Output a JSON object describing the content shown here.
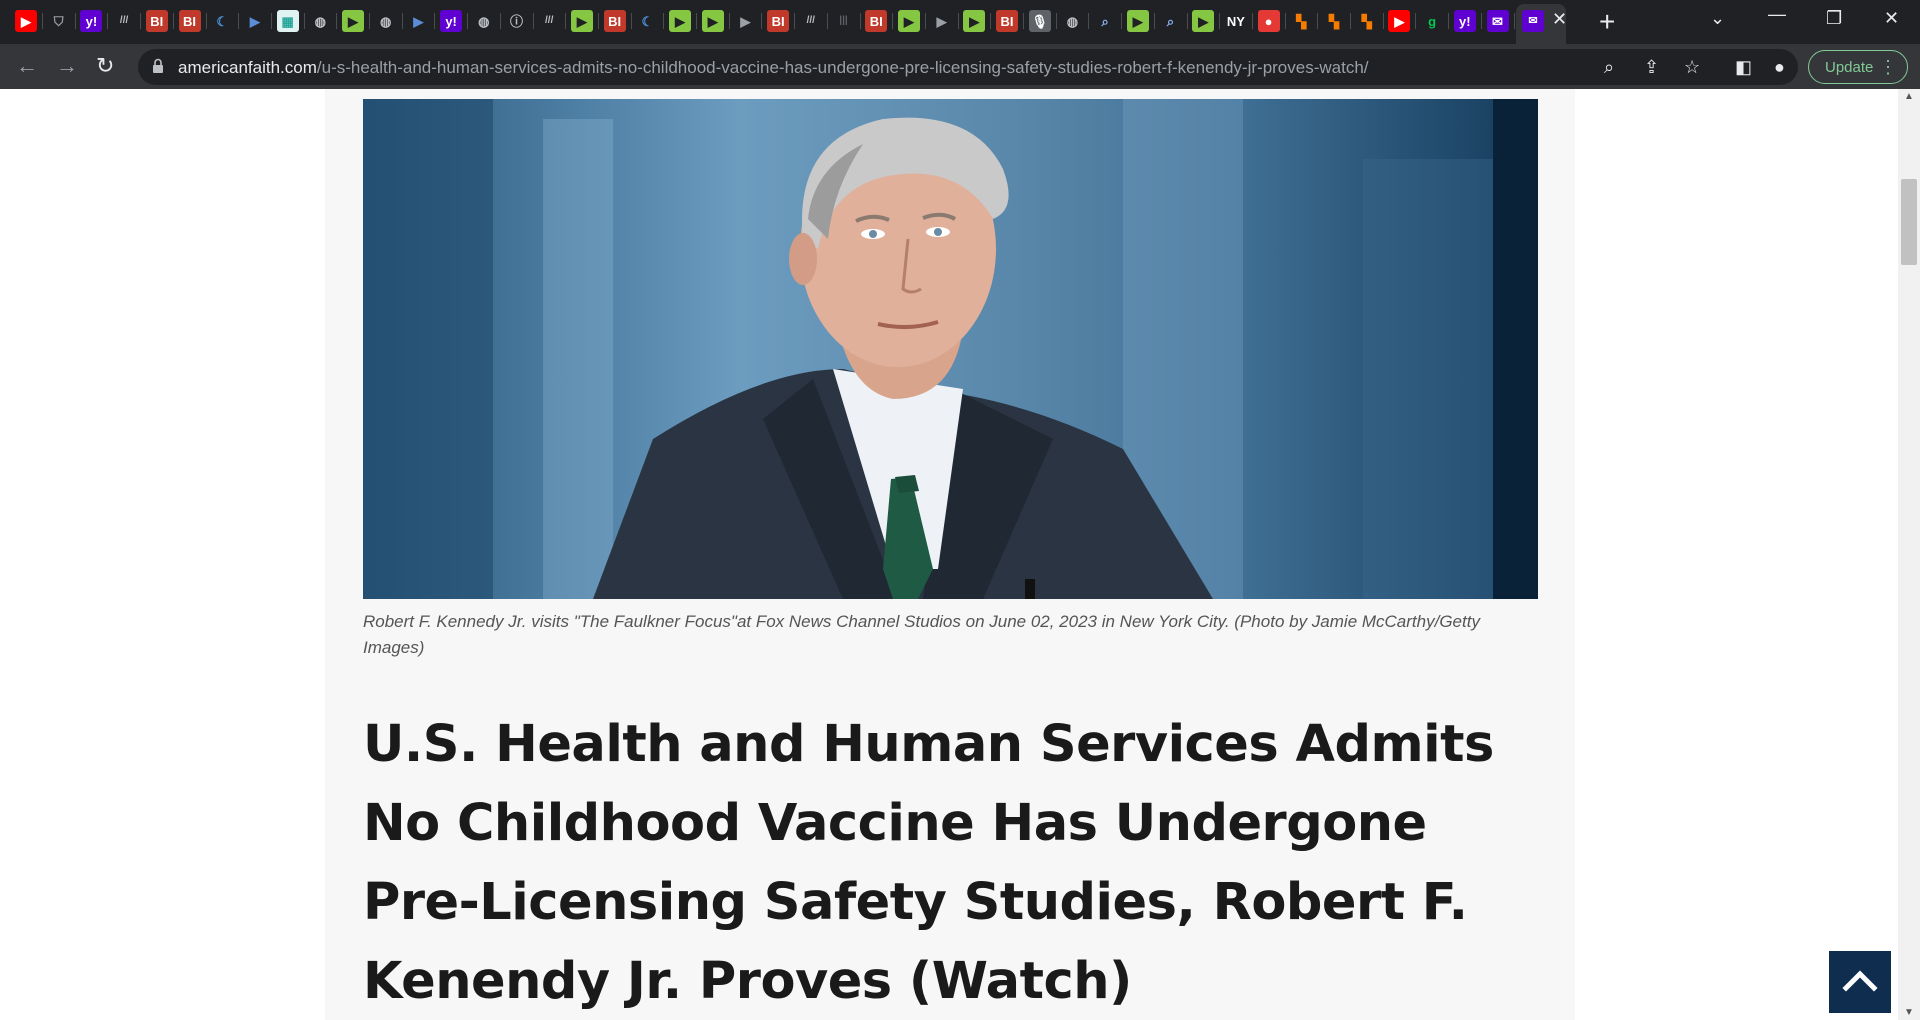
{
  "browser": {
    "tabs": [
      {
        "icon": "youtube-icon",
        "glyph": "▶",
        "color": "#ff0000",
        "fg": "#ffffff"
      },
      {
        "icon": "shield-icon",
        "glyph": "⛉",
        "color": "transparent",
        "fg": "#9aa0a6"
      },
      {
        "icon": "yahoo-icon",
        "glyph": "y!",
        "color": "#5f01d1",
        "fg": "#ffffff"
      },
      {
        "icon": "slashes-icon",
        "glyph": "///",
        "color": "transparent",
        "fg": "#bdc1c6"
      },
      {
        "icon": "business-insider-icon",
        "glyph": "BI",
        "color": "#c0392b",
        "fg": "#ffffff"
      },
      {
        "icon": "business-insider-icon",
        "glyph": "BI",
        "color": "#c0392b",
        "fg": "#ffffff"
      },
      {
        "icon": "shield-blue-icon",
        "glyph": "☾",
        "color": "transparent",
        "fg": "#4a90d9"
      },
      {
        "icon": "flag-icon",
        "glyph": "▶",
        "color": "transparent",
        "fg": "#5b8dd6"
      },
      {
        "icon": "map-icon",
        "glyph": "▦",
        "color": "#e0f2f1",
        "fg": "#26a69a"
      },
      {
        "icon": "globe-icon",
        "glyph": "◍",
        "color": "transparent",
        "fg": "#bdc1c6"
      },
      {
        "icon": "rumble-icon",
        "glyph": "▶",
        "color": "#85c742",
        "fg": "#202124"
      },
      {
        "icon": "globe-icon",
        "glyph": "◍",
        "color": "transparent",
        "fg": "#bdc1c6"
      },
      {
        "icon": "flag-icon",
        "glyph": "▶",
        "color": "transparent",
        "fg": "#5b8dd6"
      },
      {
        "icon": "yahoo-icon",
        "glyph": "y!",
        "color": "#5f01d1",
        "fg": "#ffffff"
      },
      {
        "icon": "globe-icon",
        "glyph": "◍",
        "color": "transparent",
        "fg": "#bdc1c6"
      },
      {
        "icon": "info-icon",
        "glyph": "ⓘ",
        "color": "transparent",
        "fg": "#bdc1c6"
      },
      {
        "icon": "slashes-icon",
        "glyph": "///",
        "color": "transparent",
        "fg": "#bdc1c6"
      },
      {
        "icon": "rumble-icon",
        "glyph": "▶",
        "color": "#85c742",
        "fg": "#202124"
      },
      {
        "icon": "business-insider-icon",
        "glyph": "BI",
        "color": "#c0392b",
        "fg": "#ffffff"
      },
      {
        "icon": "shield-blue-icon",
        "glyph": "☾",
        "color": "transparent",
        "fg": "#4a90d9"
      },
      {
        "icon": "rumble-icon",
        "glyph": "▶",
        "color": "#85c742",
        "fg": "#202124"
      },
      {
        "icon": "rumble-icon",
        "glyph": "▶",
        "color": "#85c742",
        "fg": "#202124"
      },
      {
        "icon": "flag-icon",
        "glyph": "▶",
        "color": "transparent",
        "fg": "#9aa0a6"
      },
      {
        "icon": "business-insider-icon",
        "glyph": "BI",
        "color": "#c0392b",
        "fg": "#ffffff"
      },
      {
        "icon": "slashes-icon",
        "glyph": "///",
        "color": "transparent",
        "fg": "#bdc1c6"
      },
      {
        "icon": "barcode-icon",
        "glyph": "|||",
        "color": "transparent",
        "fg": "#5f6368"
      },
      {
        "icon": "business-insider-icon",
        "glyph": "BI",
        "color": "#c0392b",
        "fg": "#ffffff"
      },
      {
        "icon": "rumble-icon",
        "glyph": "▶",
        "color": "#85c742",
        "fg": "#202124"
      },
      {
        "icon": "flag-icon",
        "glyph": "▶",
        "color": "transparent",
        "fg": "#9aa0a6"
      },
      {
        "icon": "rumble-icon",
        "glyph": "▶",
        "color": "#85c742",
        "fg": "#202124"
      },
      {
        "icon": "business-insider-icon",
        "glyph": "BI",
        "color": "#c0392b",
        "fg": "#ffffff"
      },
      {
        "icon": "microphone-icon",
        "glyph": "🎙",
        "color": "#5f6368",
        "fg": "#ffffff"
      },
      {
        "icon": "globe-icon",
        "glyph": "◍",
        "color": "transparent",
        "fg": "#bdc1c6"
      },
      {
        "icon": "search-icon",
        "glyph": "⌕",
        "color": "transparent",
        "fg": "#8ab4f8"
      },
      {
        "icon": "rumble-icon",
        "glyph": "▶",
        "color": "#85c742",
        "fg": "#202124"
      },
      {
        "icon": "search-icon",
        "glyph": "⌕",
        "color": "transparent",
        "fg": "#8ab4f8"
      },
      {
        "icon": "rumble-icon",
        "glyph": "▶",
        "color": "#85c742",
        "fg": "#202124"
      },
      {
        "icon": "news-icon",
        "glyph": "NY",
        "color": "#202124",
        "fg": "#ffffff"
      },
      {
        "icon": "podcast-icon",
        "glyph": "●",
        "color": "#e53935",
        "fg": "#ffffff"
      },
      {
        "icon": "bookmark-icon",
        "glyph": "▚",
        "color": "transparent",
        "fg": "#f57c00"
      },
      {
        "icon": "bookmark-icon",
        "glyph": "▚",
        "color": "transparent",
        "fg": "#f57c00"
      },
      {
        "icon": "bookmark-icon",
        "glyph": "▚",
        "color": "transparent",
        "fg": "#f57c00"
      },
      {
        "icon": "youtube-icon",
        "glyph": "▶",
        "color": "#ff0000",
        "fg": "#ffffff"
      },
      {
        "icon": "g-icon",
        "glyph": "g",
        "color": "transparent",
        "fg": "#00c853"
      },
      {
        "icon": "yahoo-icon",
        "glyph": "y!",
        "color": "#5f01d1",
        "fg": "#ffffff"
      },
      {
        "icon": "yahoo-mail-icon",
        "glyph": "✉",
        "color": "#5f01d1",
        "fg": "#ffffff"
      }
    ],
    "address": {
      "host": "americanfaith.com",
      "path": "/u-s-health-and-human-services-admits-no-childhood-vaccine-has-undergone-pre-licensing-safety-studies-robert-f-kenendy-jr-proves-watch/"
    },
    "update_label": "Update"
  },
  "article": {
    "caption": "Robert F. Kennedy Jr. visits \"The Faulkner Focus\"at Fox News Channel Studios on June 02, 2023 in New York City. (Photo by Jamie McCarthy/Getty Images)",
    "headline": "U.S. Health and Human Services Admits No Childhood Vaccine Has Undergone Pre-Licensing Safety Studies, Robert F. Kenendy Jr. Proves (Watch)"
  }
}
